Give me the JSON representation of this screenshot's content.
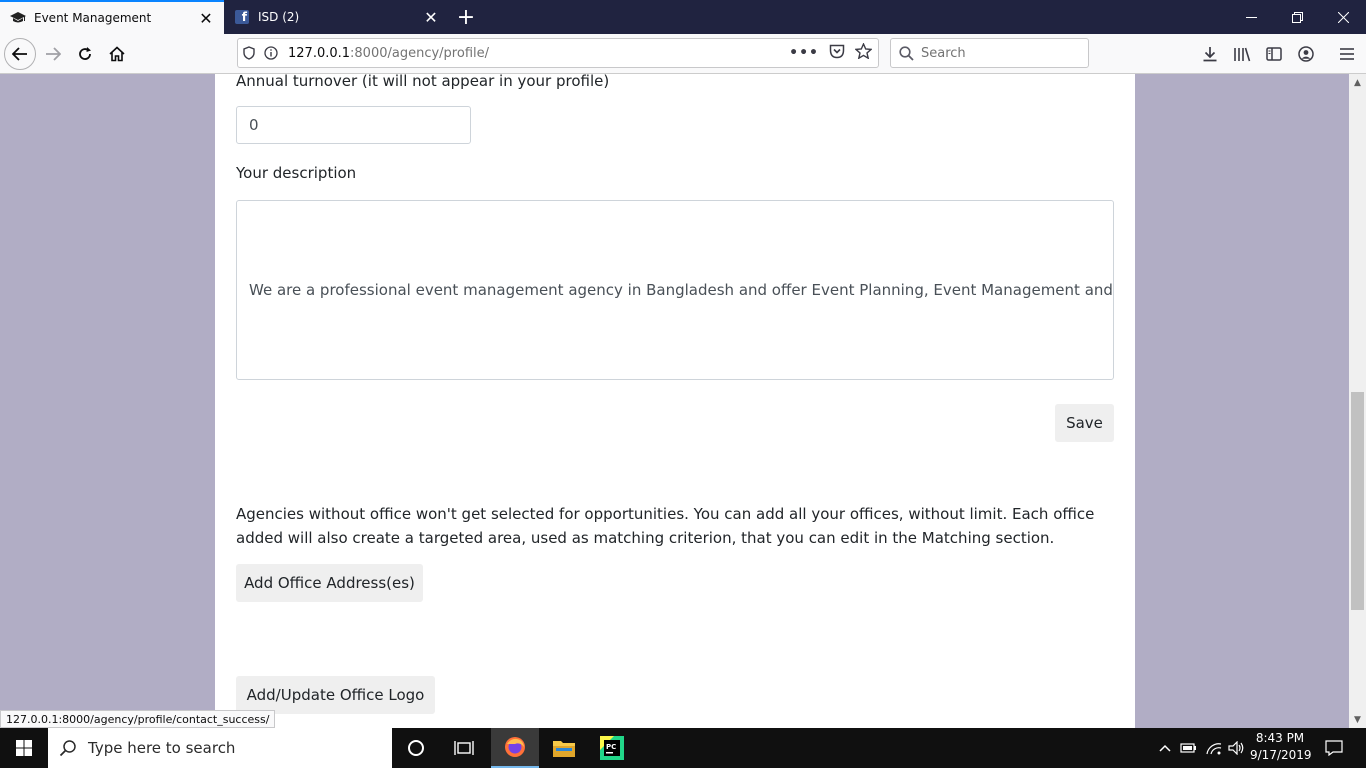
{
  "browser": {
    "tabs": [
      {
        "label": "Event Management",
        "favicon": "graduation-cap-icon",
        "active": true
      },
      {
        "label": "ISD (2)",
        "favicon": "facebook-icon",
        "active": false
      }
    ],
    "url_host": "127.0.0.1",
    "url_path": ":8000/agency/profile/",
    "search_placeholder": "Search",
    "accent_color": "#0a84ff"
  },
  "page": {
    "turnover_label": "Annual turnover (it will not appear in your profile)",
    "turnover_value": "0",
    "description_label": "Your description",
    "description_value": "We are a professional event management agency in Bangladesh  and offer Event Planning, Event Management and Event",
    "save_label": "Save",
    "office_info": "Agencies without office won't get selected for opportunities. You can add all your offices, without limit. Each office added will also create a targeted area, used as matching criterion, that you can edit in the Matching section.",
    "add_office_label": "Add Office Address(es)",
    "logo_label": "Add/Update Office Logo",
    "background_color": "#b1adc5"
  },
  "status_url": "127.0.0.1:8000/agency/profile/contact_success/",
  "taskbar": {
    "search_placeholder": "Type here to search",
    "time": "8:43 PM",
    "date": "9/17/2019"
  }
}
